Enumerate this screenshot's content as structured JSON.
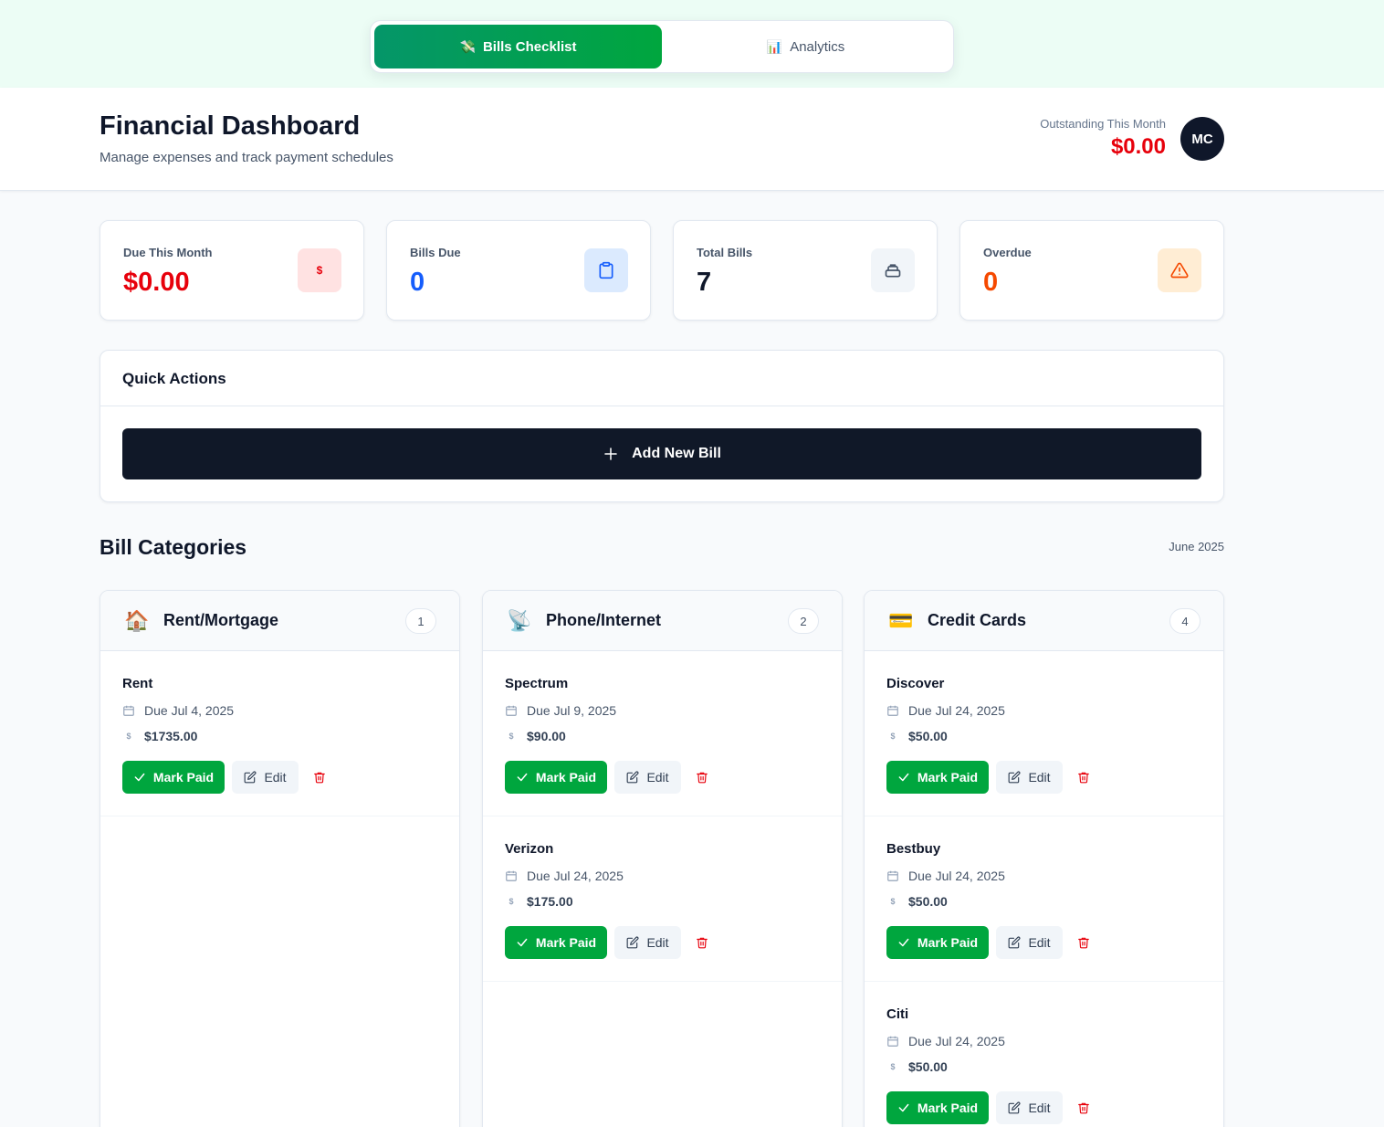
{
  "tabs": [
    {
      "label": "Bills Checklist",
      "emoji": "💸",
      "active": true
    },
    {
      "label": "Analytics",
      "emoji": "📊",
      "active": false
    }
  ],
  "header": {
    "title": "Financial Dashboard",
    "subtitle": "Manage expenses and track payment schedules",
    "outstanding_label": "Outstanding This Month",
    "outstanding_value": "$0.00",
    "avatar_initials": "MC"
  },
  "stats": [
    {
      "label": "Due This Month",
      "value": "$0.00",
      "icon": "dollar-icon",
      "color": "#e7000b",
      "icon_bg": "#ffe2e2"
    },
    {
      "label": "Bills Due",
      "value": "0",
      "icon": "clipboard-icon",
      "color": "#155dfc",
      "icon_bg": "#dbeafe"
    },
    {
      "label": "Total Bills",
      "value": "7",
      "icon": "stack-icon",
      "color": "#0f172a",
      "icon_bg": "#f1f5f9"
    },
    {
      "label": "Overdue",
      "value": "0",
      "icon": "warning-icon",
      "color": "#f54900",
      "icon_bg": "#ffedd4"
    }
  ],
  "quick_actions": {
    "title": "Quick Actions",
    "add_label": "Add New Bill"
  },
  "section": {
    "title": "Bill Categories",
    "date": "June 2025"
  },
  "buttons": {
    "mark_paid": "Mark Paid",
    "edit": "Edit"
  },
  "categories": [
    {
      "name": "Rent/Mortgage",
      "emoji": "🏠",
      "count": "1",
      "bills": [
        {
          "name": "Rent",
          "due": "Due Jul 4, 2025",
          "amount": "$1735.00"
        }
      ]
    },
    {
      "name": "Phone/Internet",
      "emoji": "📡",
      "count": "2",
      "bills": [
        {
          "name": "Spectrum",
          "due": "Due Jul 9, 2025",
          "amount": "$90.00"
        },
        {
          "name": "Verizon",
          "due": "Due Jul 24, 2025",
          "amount": "$175.00"
        }
      ]
    },
    {
      "name": "Credit Cards",
      "emoji": "💳",
      "count": "4",
      "bills": [
        {
          "name": "Discover",
          "due": "Due Jul 24, 2025",
          "amount": "$50.00"
        },
        {
          "name": "Bestbuy",
          "due": "Due Jul 24, 2025",
          "amount": "$50.00"
        },
        {
          "name": "Citi",
          "due": "Due Jul 24, 2025",
          "amount": "$50.00"
        }
      ]
    }
  ],
  "colors": {
    "accent_green": "#00a63e",
    "dark": "#101828",
    "danger": "#e7000b"
  }
}
